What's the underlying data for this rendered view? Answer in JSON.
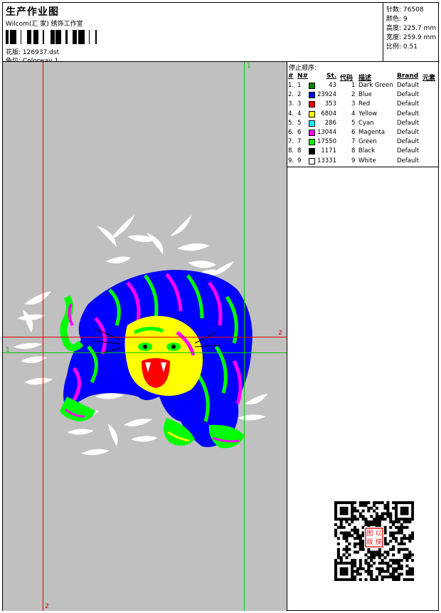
{
  "header": {
    "title": "生产作业图",
    "company": "Wilcom(汇 家) 绣饰工作室",
    "file_label": "花版:",
    "file_value": "126937.dst",
    "colorway_label": "色位:",
    "colorway_value": "Colorway 1"
  },
  "stats": [
    {
      "label": "针数:",
      "value": "76508"
    },
    {
      "label": "颜色:",
      "value": "9"
    },
    {
      "label": "高度:",
      "value": "225.7 mm"
    },
    {
      "label": "宽度:",
      "value": "259.9 mm"
    },
    {
      "label": "比例:",
      "value": "0.51"
    }
  ],
  "canvas": {
    "marker_1_top": "1",
    "marker_1_left": "1",
    "marker_2_right": "2",
    "marker_2_bottom": "2",
    "line_green": "#00cc00",
    "line_red": "#e00000",
    "background": "#c0c0c0"
  },
  "table": {
    "title": "停止顺序:",
    "headers": {
      "hash": "#",
      "n": "N#",
      "st": "St.",
      "code": "代码",
      "desc": "描述",
      "brand": "Brand",
      "elem": "元素"
    },
    "rows": [
      {
        "num": "1.",
        "n": "1",
        "color": "#008000",
        "st": "43",
        "code": "1",
        "desc": "Dark Green",
        "brand": "Default"
      },
      {
        "num": "2.",
        "n": "2",
        "color": "#0000ff",
        "st": "23924",
        "code": "2",
        "desc": "Blue",
        "brand": "Default"
      },
      {
        "num": "3.",
        "n": "3",
        "color": "#ff0000",
        "st": "353",
        "code": "3",
        "desc": "Red",
        "brand": "Default"
      },
      {
        "num": "4.",
        "n": "4",
        "color": "#ffff00",
        "st": "6804",
        "code": "4",
        "desc": "Yellow",
        "brand": "Default"
      },
      {
        "num": "5.",
        "n": "5",
        "color": "#00ffff",
        "st": "286",
        "code": "5",
        "desc": "Cyan",
        "brand": "Default"
      },
      {
        "num": "6.",
        "n": "6",
        "color": "#ff00ff",
        "st": "13044",
        "code": "6",
        "desc": "Magenta",
        "brand": "Default"
      },
      {
        "num": "7.",
        "n": "7",
        "color": "#00ff00",
        "st": "17550",
        "code": "7",
        "desc": "Green",
        "brand": "Default"
      },
      {
        "num": "8.",
        "n": "8",
        "color": "#000000",
        "st": "1171",
        "code": "8",
        "desc": "Black",
        "brand": "Default"
      },
      {
        "num": "9.",
        "n": "9",
        "color": "#ffffff",
        "st": "13331",
        "code": "9",
        "desc": "White",
        "brand": "Default"
      }
    ]
  },
  "qr": {
    "icon": "qr-code-icon",
    "seal_text": "以图搜版",
    "seal_color": "#e02020"
  }
}
